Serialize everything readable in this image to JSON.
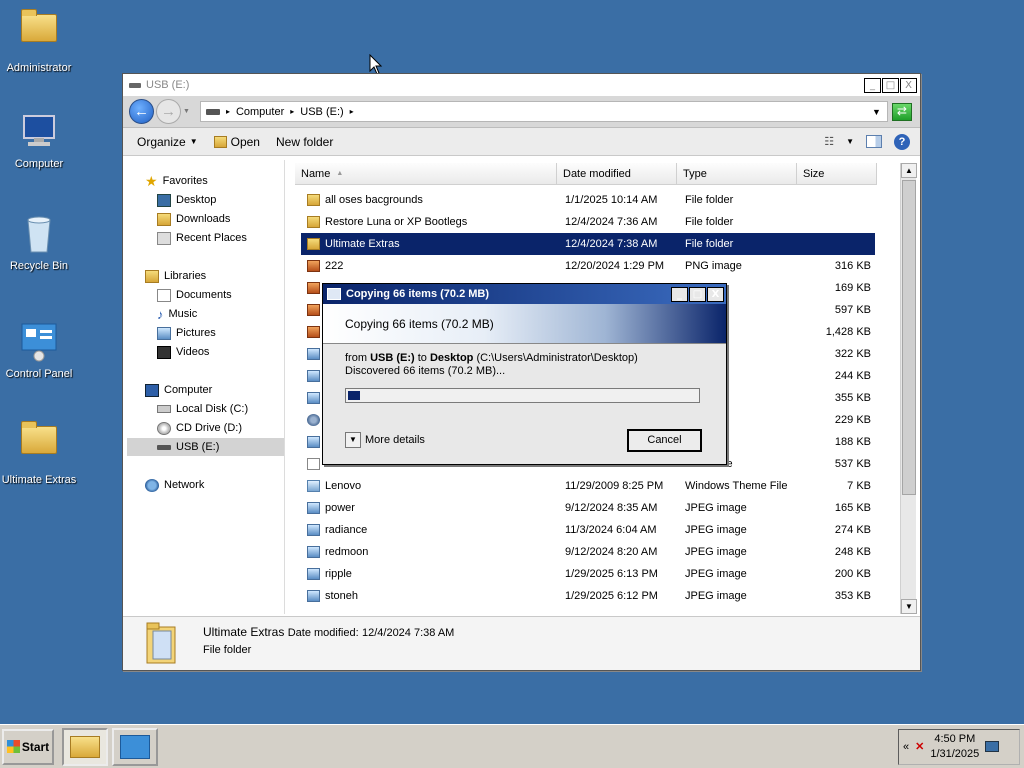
{
  "desktop": {
    "icons": [
      {
        "label": "Administrator"
      },
      {
        "label": "Computer"
      },
      {
        "label": "Recycle Bin"
      },
      {
        "label": "Control Panel"
      },
      {
        "label": "Ultimate Extras"
      }
    ]
  },
  "window": {
    "title": "USB (E:)",
    "title_buttons": {
      "minimize": "_",
      "maximize": "□",
      "close": "X"
    },
    "address": {
      "segments": [
        "Computer",
        "USB (E:)"
      ]
    },
    "toolbar": {
      "organize": "Organize",
      "open": "Open",
      "new_folder": "New folder"
    },
    "nav_pane": {
      "favorites": "Favorites",
      "favorites_items": [
        "Desktop",
        "Downloads",
        "Recent Places"
      ],
      "libraries": "Libraries",
      "libraries_items": [
        "Documents",
        "Music",
        "Pictures",
        "Videos"
      ],
      "computer": "Computer",
      "computer_items": [
        "Local Disk (C:)",
        "CD Drive (D:)",
        "USB (E:)"
      ],
      "network": "Network"
    },
    "columns": {
      "name": "Name",
      "date": "Date modified",
      "type": "Type",
      "size": "Size"
    },
    "rows": [
      {
        "name": "all oses bacgrounds",
        "date": "1/1/2025 10:14 AM",
        "type": "File folder",
        "size": "",
        "icon": "folder"
      },
      {
        "name": "Restore Luna or XP Bootlegs",
        "date": "12/4/2024 7:36 AM",
        "type": "File folder",
        "size": "",
        "icon": "folder"
      },
      {
        "name": "Ultimate Extras",
        "date": "12/4/2024 7:38 AM",
        "type": "File folder",
        "size": "",
        "icon": "folder"
      },
      {
        "name": "222",
        "date": "12/20/2024 1:29 PM",
        "type": "PNG image",
        "size": "316 KB",
        "icon": "png"
      },
      {
        "name": "",
        "date": "",
        "type": "e",
        "size": "169 KB",
        "icon": "png"
      },
      {
        "name": "",
        "date": "",
        "type": "e",
        "size": "597 KB",
        "icon": "png"
      },
      {
        "name": "",
        "date": "",
        "type": "e",
        "size": "1,428 KB",
        "icon": "png"
      },
      {
        "name": "",
        "date": "",
        "type": "age",
        "size": "322 KB",
        "icon": "jpg"
      },
      {
        "name": "",
        "date": "",
        "type": "age",
        "size": "244 KB",
        "icon": "jpg"
      },
      {
        "name": "",
        "date": "",
        "type": "age",
        "size": "355 KB",
        "icon": "jpg"
      },
      {
        "name": "",
        "date": "",
        "type": "on",
        "size": "229 KB",
        "icon": "gear"
      },
      {
        "name": "",
        "date": "",
        "type": "age",
        "size": "188 KB",
        "icon": "jpg"
      },
      {
        "name": "intro.wmv",
        "date": "2/19/2013 10:03 AM",
        "type": "WMV File",
        "size": "537 KB",
        "icon": "wmv"
      },
      {
        "name": "Lenovo",
        "date": "11/29/2009 8:25 PM",
        "type": "Windows Theme File",
        "size": "7 KB",
        "icon": "theme"
      },
      {
        "name": "power",
        "date": "9/12/2024 8:35 AM",
        "type": "JPEG image",
        "size": "165 KB",
        "icon": "jpg"
      },
      {
        "name": "radiance",
        "date": "11/3/2024 6:04 AM",
        "type": "JPEG image",
        "size": "274 KB",
        "icon": "jpg"
      },
      {
        "name": "redmoon",
        "date": "9/12/2024 8:20 AM",
        "type": "JPEG image",
        "size": "248 KB",
        "icon": "jpg"
      },
      {
        "name": "ripple",
        "date": "1/29/2025 6:13 PM",
        "type": "JPEG image",
        "size": "200 KB",
        "icon": "jpg"
      },
      {
        "name": "stoneh",
        "date": "1/29/2025 6:12 PM",
        "type": "JPEG image",
        "size": "353 KB",
        "icon": "jpg"
      }
    ],
    "details": {
      "name": "Ultimate Extras",
      "date_label": "Date modified:",
      "date_value": "12/4/2024 7:38 AM",
      "type": "File folder"
    }
  },
  "copy_dialog": {
    "title": "Copying 66 items (70.2 MB)",
    "heading": "Copying 66 items (70.2 MB)",
    "from_prefix": "from",
    "from": "USB (E:)",
    "to_prefix": "to",
    "to": "Desktop",
    "to_path": "(C:\\Users\\Administrator\\Desktop)",
    "discovered": "Discovered 66 items (70.2 MB)...",
    "progress_fraction": 0.03,
    "more_details": "More details",
    "cancel": "Cancel"
  },
  "taskbar": {
    "start": "Start",
    "time": "4:50 PM",
    "date": "1/31/2025",
    "tray_expand": "«"
  }
}
